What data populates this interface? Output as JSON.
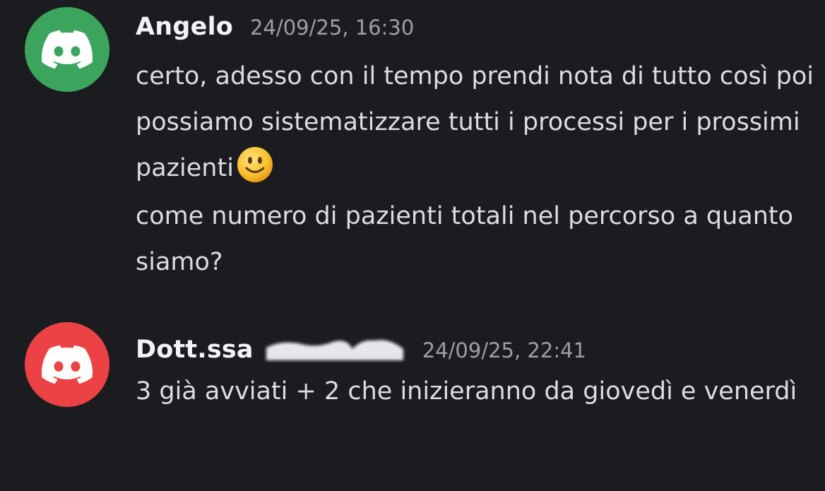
{
  "colors": {
    "background": "#1b1c20",
    "avatar_green": "#3ba55d",
    "avatar_red": "#ed4245",
    "text": "#dcdde1",
    "author": "#f2f3f5",
    "timestamp": "#9d9fa6"
  },
  "messages": [
    {
      "avatar_icon": "discord-logo-icon",
      "avatar_color": "#3ba55d",
      "author": "Angelo",
      "timestamp": "24/09/25, 16:30",
      "paragraphs": [
        "certo, adesso con il tempo prendi nota di tutto così poi possiamo sistematizzare tutti i processi per i prossimi pazienti",
        "come numero di pazienti totali nel percorso a quanto siamo?"
      ],
      "emoji": "slightly-smiling-face-emoji"
    },
    {
      "avatar_icon": "discord-logo-icon",
      "avatar_color": "#ed4245",
      "author": "Dott.ssa",
      "author_redacted": true,
      "timestamp": "24/09/25, 22:41",
      "paragraphs": [
        "3 già avviati + 2 che inizieranno da giovedì e venerdì"
      ]
    }
  ]
}
